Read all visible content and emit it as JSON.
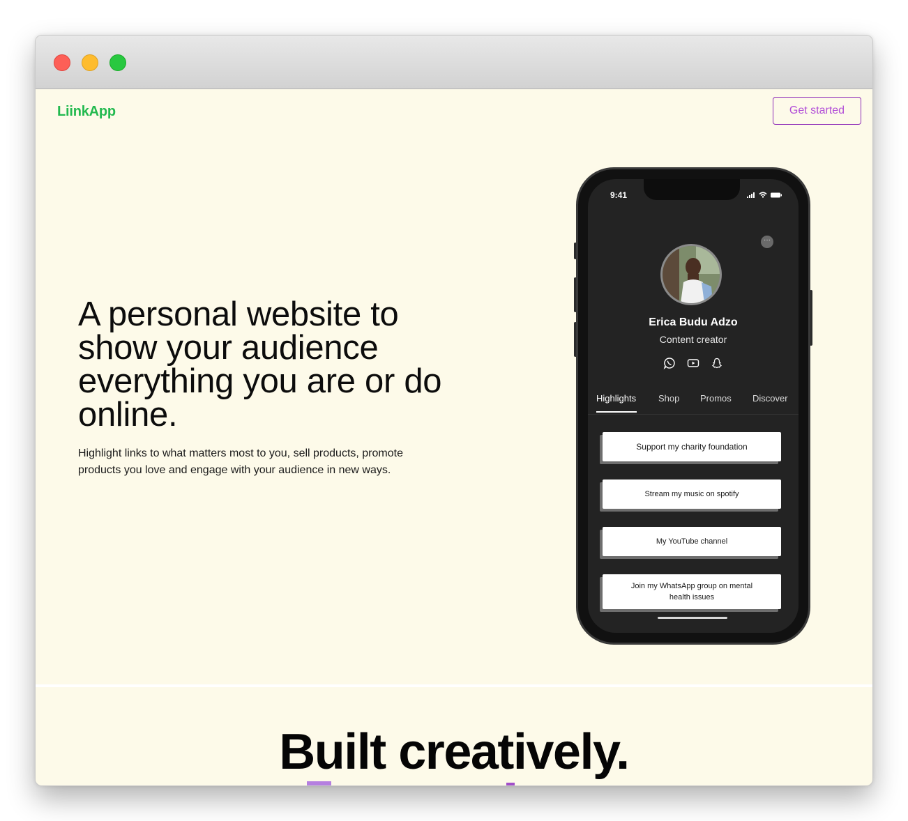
{
  "nav": {
    "logo": "LiinkApp",
    "cta_label": "Get started"
  },
  "hero": {
    "headline": "A personal website to show your audience everything you are or do online.",
    "subtext": "Highlight links to what matters most to you, sell products, promote products you love and engage with your audience in new ways."
  },
  "phone": {
    "time": "9:41",
    "more_label": "···",
    "profile": {
      "name": "Erica Budu Adzo",
      "role": "Content creator"
    },
    "socials": [
      "whatsapp-icon",
      "youtube-icon",
      "snapchat-icon"
    ],
    "tabs": [
      {
        "label": "Highlights",
        "active": true
      },
      {
        "label": "Shop",
        "active": false
      },
      {
        "label": "Promos",
        "active": false
      },
      {
        "label": "Discover",
        "active": false
      }
    ],
    "links": [
      {
        "label": "Support my charity foundation"
      },
      {
        "label": "Stream my music on spotify"
      },
      {
        "label": "My YouTube channel"
      },
      {
        "label": "Join my WhatsApp group on mental health issues"
      }
    ]
  },
  "section2": {
    "title": "Built creatively."
  },
  "colors": {
    "brand_green": "#22b94f",
    "accent_purple": "#8e2bb7",
    "page_bg": "#fdfae9",
    "phone_screen": "#232323"
  }
}
